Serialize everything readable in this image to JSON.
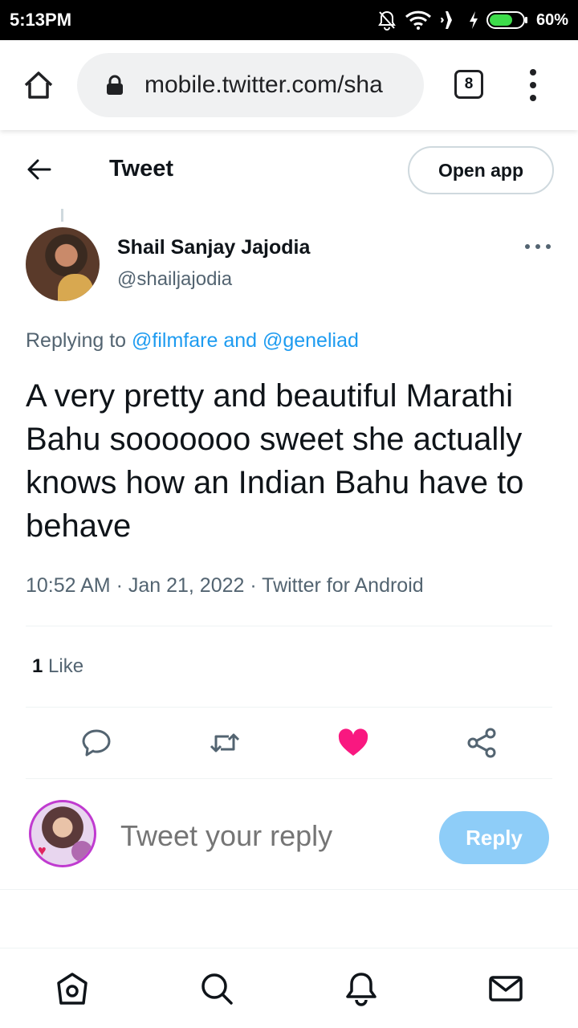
{
  "status_bar": {
    "time": "5:13PM",
    "battery": "60%",
    "icons": [
      "notifications-off-icon",
      "wifi-icon",
      "airplane-icon",
      "charging-icon",
      "battery-icon"
    ]
  },
  "browser": {
    "url": "mobile.twitter.com/sha",
    "tab_count": "8"
  },
  "header": {
    "title": "Tweet",
    "open_app_label": "Open app"
  },
  "tweet": {
    "author_name": "Shail Sanjay Jajodia",
    "author_handle": "@shailjajodia",
    "replying_prefix": "Replying to",
    "replying_mentions": "@filmfare and @geneliad",
    "text": "A very pretty and beautiful Marathi Bahu sooooooo sweet she actually knows how an Indian Bahu have to behave",
    "meta": "10:52 AM · Jan 21, 2022 · Twitter for Android",
    "like_count": "1",
    "like_label": "Like",
    "liked": true
  },
  "reply": {
    "placeholder": "Tweet your reply",
    "button_label": "Reply"
  },
  "colors": {
    "accent": "#1d9bf0",
    "like": "#f91880",
    "reply_button_disabled": "#8ecdf8",
    "muted_text": "#536471"
  },
  "bottom_nav": [
    "home-icon",
    "search-icon",
    "notifications-icon",
    "messages-icon"
  ]
}
